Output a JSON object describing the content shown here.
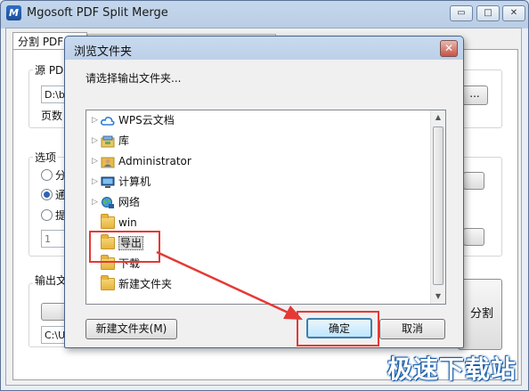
{
  "app": {
    "title": "Mgosoft PDF Split Merge",
    "logo_letter": "M",
    "minimize_glyph": "▭",
    "maximize_glyph": "□",
    "close_glyph": "✕"
  },
  "background": {
    "tab_label": "分割 PDF 文件",
    "source_label": "源 PDF",
    "source_path": "D:\\ba",
    "pages_label": "页数",
    "browse_label": "...",
    "options_label": "选项",
    "radio_1": "分",
    "radio_2": "通",
    "radio_3": "提",
    "spin_value": "1",
    "output_label": "输出文",
    "output_path": "C:\\U",
    "split_button": "分割"
  },
  "dialog": {
    "title": "浏览文件夹",
    "close_glyph": "✕",
    "prompt": "请选择输出文件夹...",
    "tree": [
      {
        "label": "WPS云文档",
        "icon": "cloud-icon",
        "expandable": true
      },
      {
        "label": "库",
        "icon": "library-icon",
        "expandable": true
      },
      {
        "label": "Administrator",
        "icon": "user-icon",
        "expandable": true
      },
      {
        "label": "计算机",
        "icon": "computer-icon",
        "expandable": true
      },
      {
        "label": "网络",
        "icon": "network-icon",
        "expandable": true
      },
      {
        "label": "win",
        "icon": "folder-icon",
        "expandable": false
      },
      {
        "label": "导出",
        "icon": "folder-icon",
        "expandable": false,
        "selected": true
      },
      {
        "label": "下载",
        "icon": "folder-icon",
        "expandable": false
      },
      {
        "label": "新建文件夹",
        "icon": "folder-icon",
        "expandable": false
      }
    ],
    "new_folder_button": "新建文件夹(M)",
    "ok_button": "确定",
    "cancel_button": "取消"
  },
  "annotation_color": "#e53935",
  "watermark": "极速下载站"
}
